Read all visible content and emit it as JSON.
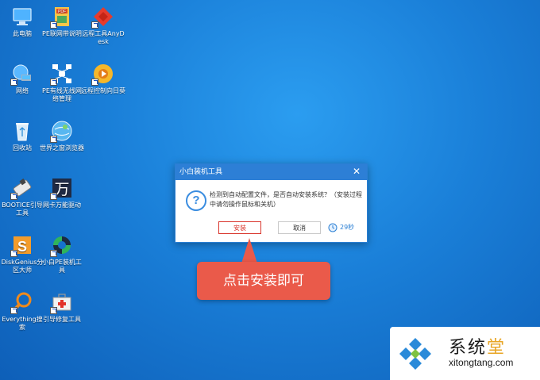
{
  "desktop": {
    "icons": [
      {
        "id": "this-pc",
        "label": "此电脑"
      },
      {
        "id": "pe-network",
        "label": "PE联网带说明"
      },
      {
        "id": "anydesk",
        "label": "远程工具AnyDesk"
      },
      {
        "id": "network",
        "label": "网络"
      },
      {
        "id": "pe-wired-wireless",
        "label": "PE有线无线网络管理"
      },
      {
        "id": "remote-control",
        "label": "远程控制向日葵"
      },
      {
        "id": "recycle-bin",
        "label": "回收站"
      },
      {
        "id": "world-browser",
        "label": "世界之窗浏览器"
      },
      {
        "id": "bootice",
        "label": "BOOTICE引导工具"
      },
      {
        "id": "wanneng-driver",
        "label": "网卡万能驱动"
      },
      {
        "id": "diskgenius",
        "label": "DiskGenius分区大师"
      },
      {
        "id": "xiaobai-install",
        "label": "小白PE装机工具"
      },
      {
        "id": "everything",
        "label": "Everything搜索"
      },
      {
        "id": "boot-repair",
        "label": "引导修复工具"
      }
    ]
  },
  "dialog": {
    "title": "小白装机工具",
    "message": "检测到自动配置文件，是否自动安装系统？（安装过程中请勿操作鼠标和关机）",
    "install_label": "安装",
    "cancel_label": "取消",
    "countdown": "29秒"
  },
  "callout": {
    "text": "点击安装即可"
  },
  "watermark": {
    "title_main": "系统",
    "title_accent": "堂",
    "url": "xitongtang.com"
  },
  "colors": {
    "dialog_title": "#2d7fd6",
    "install_button": "#d9342b",
    "callout": "#ea5a4a"
  }
}
